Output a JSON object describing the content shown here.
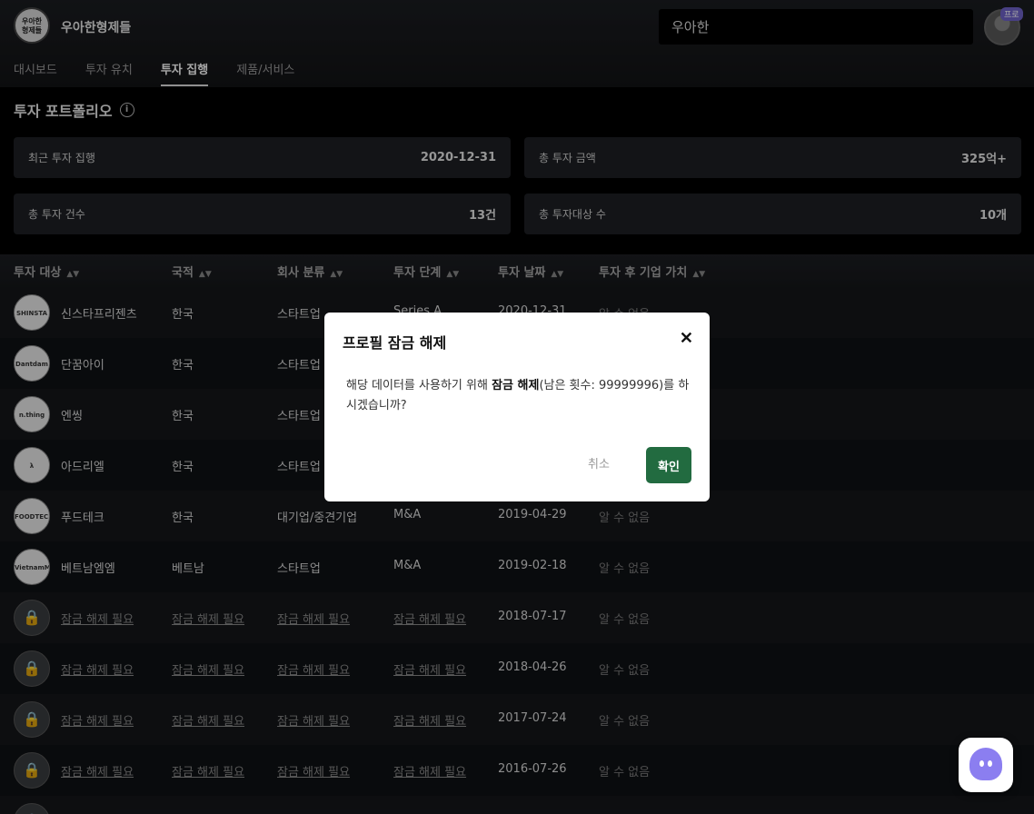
{
  "header": {
    "logo_text": "우아한\n형제들",
    "company_name": "우아한형제들",
    "search_value": "우아한",
    "pro_badge": "프로"
  },
  "tabs": [
    {
      "label": "대시보드",
      "active": false
    },
    {
      "label": "투자 유치",
      "active": false
    },
    {
      "label": "투자 집행",
      "active": true
    },
    {
      "label": "제품/서비스",
      "active": false
    }
  ],
  "portfolio": {
    "title": "투자 포트폴리오",
    "info_icon": "i",
    "cards": [
      {
        "label": "최근 투자 집행",
        "value": "2020-12-31"
      },
      {
        "label": "총 투자 금액",
        "value": "325억+"
      },
      {
        "label": "총 투자 건수",
        "value": "13건"
      },
      {
        "label": "총 투자대상 수",
        "value": "10개"
      }
    ]
  },
  "table": {
    "sort_icon": "▲▼",
    "headers": [
      "투자 대상",
      "국적",
      "회사 분류",
      "투자 단계",
      "투자 날짜",
      "투자 후 기업 가치"
    ],
    "rows": [
      {
        "logo": "SHINSTA",
        "name": "신스타프리젠츠",
        "country": "한국",
        "category": "스타트업",
        "stage": "Series A",
        "date": "2020-12-31",
        "value": "알 수 없음",
        "locked": false
      },
      {
        "logo": "Dantdam",
        "name": "단꿈아이",
        "country": "한국",
        "category": "스타트업",
        "stage": "",
        "date": "",
        "value": "",
        "locked": false
      },
      {
        "logo": "n.thing",
        "name": "엔씽",
        "country": "한국",
        "category": "스타트업",
        "stage": "",
        "date": "",
        "value": "",
        "locked": false
      },
      {
        "logo": "λ",
        "name": "아드리엘",
        "country": "한국",
        "category": "스타트업",
        "stage": "",
        "date": "",
        "value": "",
        "locked": false
      },
      {
        "logo": "FOODTECH",
        "name": "푸드테크",
        "country": "한국",
        "category": "대기업/중견기업",
        "stage": "M&A",
        "date": "2019-04-29",
        "value": "알 수 없음",
        "locked": false
      },
      {
        "logo": "VietnamMM",
        "name": "베트남엠엠",
        "country": "베트남",
        "category": "스타트업",
        "stage": "M&A",
        "date": "2019-02-18",
        "value": "알 수 없음",
        "locked": false
      },
      {
        "logo": "🔒",
        "name": "잠금 해제 필요",
        "country": "잠금 해제 필요",
        "category": "잠금 해제 필요",
        "stage": "잠금 해제 필요",
        "date": "2018-07-17",
        "value": "알 수 없음",
        "locked": true
      },
      {
        "logo": "🔒",
        "name": "잠금 해제 필요",
        "country": "잠금 해제 필요",
        "category": "잠금 해제 필요",
        "stage": "잠금 해제 필요",
        "date": "2018-04-26",
        "value": "알 수 없음",
        "locked": true
      },
      {
        "logo": "🔒",
        "name": "잠금 해제 필요",
        "country": "잠금 해제 필요",
        "category": "잠금 해제 필요",
        "stage": "잠금 해제 필요",
        "date": "2017-07-24",
        "value": "알 수 없음",
        "locked": true
      },
      {
        "logo": "🔒",
        "name": "잠금 해제 필요",
        "country": "잠금 해제 필요",
        "category": "잠금 해제 필요",
        "stage": "잠금 해제 필요",
        "date": "2016-07-26",
        "value": "알 수 없음",
        "locked": true
      },
      {
        "logo": "🔒",
        "name": "",
        "country": "",
        "category": "",
        "stage": "",
        "date": "",
        "value": "",
        "locked": true
      }
    ]
  },
  "modal": {
    "title": "프로필 잠금 해제",
    "close_icon": "✕",
    "body_prefix": "해당 데이터를 사용하기 위해 ",
    "body_bold": "잠금 해제",
    "body_suffix": "(남은 횟수: 99999996)를 하시겠습니까?",
    "cancel_label": "취소",
    "confirm_label": "확인"
  },
  "colors": {
    "confirm_button": "#226b40",
    "pro_badge": "#6f63c9",
    "chat_icon": "#8b7ef0"
  },
  "icons": {
    "info": "info-icon",
    "sort": "sort-icon",
    "lock": "lock-icon",
    "close": "close-icon",
    "chat": "chat-ghost-icon"
  }
}
